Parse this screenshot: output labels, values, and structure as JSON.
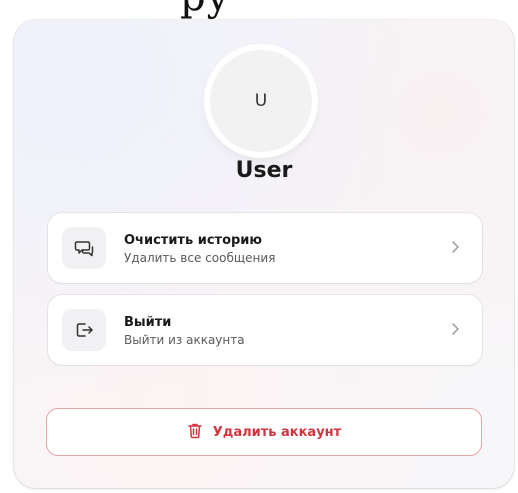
{
  "top_fragment": "py",
  "profile": {
    "avatar_letter": "U",
    "name": "User"
  },
  "actions": [
    {
      "title": "Очистить историю",
      "subtitle": "Удалить все сообщения",
      "icon": "chat-bubbles-icon"
    },
    {
      "title": "Выйти",
      "subtitle": "Выйти из аккаунта",
      "icon": "logout-icon"
    }
  ],
  "danger": {
    "label": "Удалить аккаунт",
    "icon": "trash-icon",
    "color": "#d3353f",
    "border_color": "#e8a5aa"
  }
}
